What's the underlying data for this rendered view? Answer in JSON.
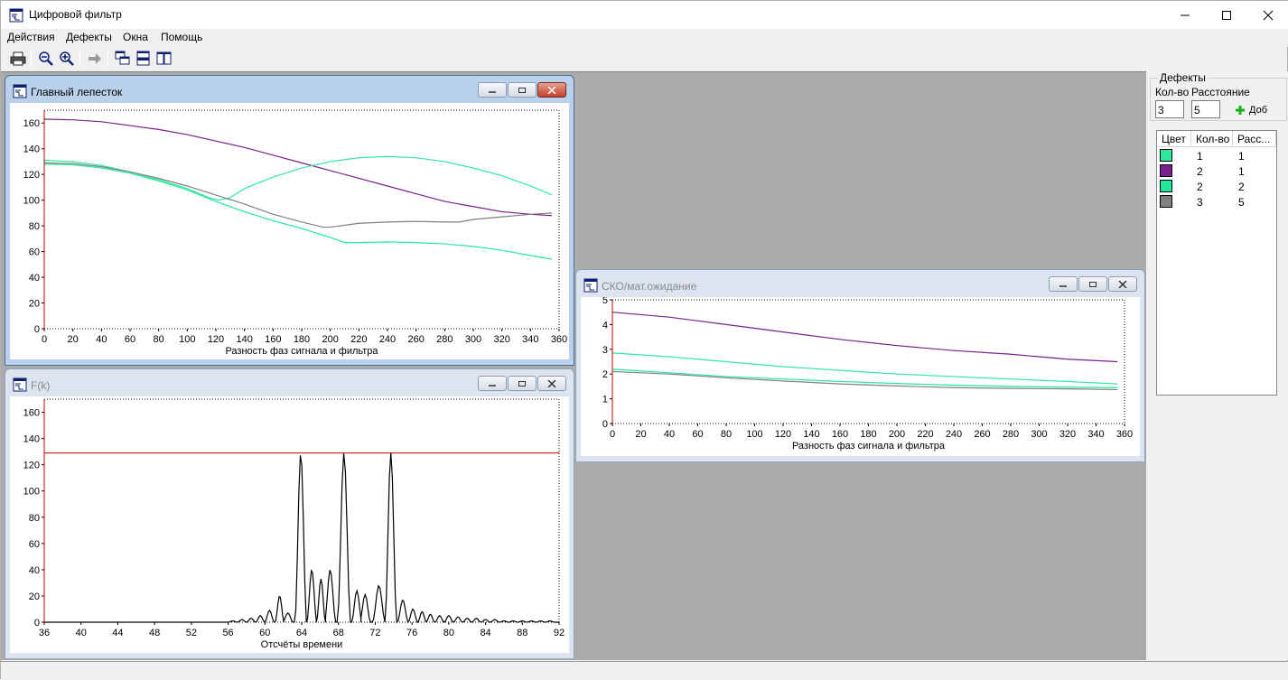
{
  "app": {
    "title": "Цифровой фильтр"
  },
  "menu": {
    "items": [
      "Действия",
      "Дефекты",
      "Окна",
      "Помощь"
    ]
  },
  "windows": {
    "main_lobe": {
      "title": "Главный лепесток"
    },
    "fk": {
      "title": "F(k)"
    },
    "sko": {
      "title": "СКО/мат.ожидание"
    }
  },
  "defects": {
    "group_label": "Дефекты",
    "count_label": "Кол-во",
    "distance_label": "Расстояние",
    "count_value": "3",
    "distance_value": "5",
    "add_label": "Доб",
    "columns": [
      "Цвет",
      "Кол-во",
      "Расс..."
    ],
    "rows": [
      {
        "color": "#2ee8a0",
        "count": "1",
        "distance": "1"
      },
      {
        "color": "#7a1f8e",
        "count": "2",
        "distance": "1"
      },
      {
        "color": "#23e89a",
        "count": "2",
        "distance": "2"
      },
      {
        "color": "#808080",
        "count": "3",
        "distance": "5"
      }
    ]
  },
  "chart_data": [
    {
      "type": "line",
      "xlabel": "Разность фаз сигнала и фильтра",
      "ylabel": "",
      "xlim": [
        0,
        360
      ],
      "ylim": [
        0,
        170
      ],
      "xticks": [
        0,
        20,
        40,
        60,
        80,
        100,
        120,
        140,
        160,
        180,
        200,
        220,
        240,
        260,
        280,
        300,
        320,
        340,
        360
      ],
      "yticks": [
        0,
        20,
        40,
        60,
        80,
        100,
        120,
        140,
        160
      ],
      "series": [
        {
          "color": "#7a1f8e",
          "x": [
            0,
            20,
            40,
            60,
            80,
            100,
            120,
            140,
            160,
            180,
            200,
            220,
            240,
            260,
            280,
            300,
            320,
            340,
            355
          ],
          "y": [
            163,
            162.5,
            161,
            158,
            155,
            151,
            146,
            141,
            135,
            129,
            123,
            117,
            111,
            105,
            99,
            95,
            91,
            89,
            88
          ]
        },
        {
          "color": "#2ee8a0",
          "x": [
            0,
            20,
            40,
            60,
            80,
            100,
            115,
            122,
            130,
            140,
            160,
            180,
            200,
            220,
            240,
            260,
            280,
            300,
            320,
            340,
            355
          ],
          "y": [
            131,
            130,
            127,
            122,
            116,
            109,
            102,
            100,
            102,
            109,
            118,
            125,
            130,
            133,
            134,
            133,
            130,
            125,
            119,
            111,
            104
          ]
        },
        {
          "color": "#23e89a",
          "x": [
            0,
            20,
            40,
            60,
            80,
            100,
            120,
            140,
            160,
            180,
            200,
            210,
            220,
            240,
            260,
            280,
            300,
            320,
            340,
            355
          ],
          "y": [
            128,
            127.5,
            125,
            121,
            115,
            108,
            99,
            91,
            84,
            78,
            71,
            67,
            67,
            67.5,
            67,
            66,
            64,
            61,
            57,
            54
          ]
        },
        {
          "color": "#808080",
          "x": [
            0,
            20,
            40,
            60,
            80,
            100,
            120,
            140,
            160,
            180,
            195,
            200,
            220,
            240,
            260,
            280,
            290,
            300,
            320,
            340,
            355
          ],
          "y": [
            129,
            128.5,
            126,
            122,
            117,
            111,
            104,
            97,
            89,
            83,
            79,
            79,
            82,
            83,
            83.5,
            83,
            83,
            85,
            87,
            89,
            90
          ]
        }
      ]
    },
    {
      "type": "line",
      "xlabel": "Отсчёты времени",
      "ylabel": "",
      "xlim": [
        36,
        92
      ],
      "ylim": [
        0,
        170
      ],
      "xticks": [
        36,
        40,
        44,
        48,
        52,
        56,
        60,
        64,
        68,
        72,
        76,
        80,
        84,
        88,
        92
      ],
      "yticks": [
        0,
        20,
        40,
        60,
        80,
        100,
        120,
        140,
        160
      ],
      "threshold": {
        "value": 129,
        "color": "#c00000"
      },
      "series": [
        {
          "color": "#000000",
          "peaks": [
            {
              "c": 56.5,
              "h": 1
            },
            {
              "c": 57.5,
              "h": 2
            },
            {
              "c": 58.5,
              "h": 3
            },
            {
              "c": 59.5,
              "h": 5
            },
            {
              "c": 60.5,
              "h": 9
            },
            {
              "c": 61.6,
              "h": 20
            },
            {
              "c": 62.5,
              "h": 7
            },
            {
              "c": 63.9,
              "h": 129
            },
            {
              "c": 65.1,
              "h": 40
            },
            {
              "c": 66.1,
              "h": 33
            },
            {
              "c": 67.1,
              "h": 40
            },
            {
              "c": 68.6,
              "h": 129
            },
            {
              "c": 70.0,
              "h": 24
            },
            {
              "c": 70.9,
              "h": 21
            },
            {
              "c": 72.4,
              "h": 28
            },
            {
              "c": 73.7,
              "h": 129
            },
            {
              "c": 75.0,
              "h": 17
            },
            {
              "c": 76.1,
              "h": 10
            },
            {
              "c": 77.1,
              "h": 8
            },
            {
              "c": 78.0,
              "h": 6
            },
            {
              "c": 79.0,
              "h": 5
            },
            {
              "c": 80.0,
              "h": 5
            },
            {
              "c": 81.0,
              "h": 4
            },
            {
              "c": 82.0,
              "h": 3
            },
            {
              "c": 83.0,
              "h": 3
            },
            {
              "c": 84.0,
              "h": 2
            },
            {
              "c": 85.0,
              "h": 2
            },
            {
              "c": 86.0,
              "h": 1
            },
            {
              "c": 87.0,
              "h": 1
            },
            {
              "c": 88.0,
              "h": 1
            },
            {
              "c": 89.0,
              "h": 1
            },
            {
              "c": 90.0,
              "h": 1
            },
            {
              "c": 91.0,
              "h": 1
            }
          ]
        }
      ]
    },
    {
      "type": "line",
      "xlabel": "Разность фаз сигнала и фильтра",
      "ylabel": "",
      "xlim": [
        0,
        360
      ],
      "ylim": [
        0,
        5
      ],
      "xticks": [
        0,
        20,
        40,
        60,
        80,
        100,
        120,
        140,
        160,
        180,
        200,
        220,
        240,
        260,
        280,
        300,
        320,
        340,
        360
      ],
      "yticks": [
        0,
        1,
        2,
        3,
        4,
        5
      ],
      "series": [
        {
          "color": "#7a1f8e",
          "x": [
            0,
            40,
            80,
            120,
            160,
            200,
            240,
            280,
            320,
            355
          ],
          "y": [
            4.5,
            4.3,
            4.0,
            3.7,
            3.4,
            3.15,
            2.95,
            2.8,
            2.6,
            2.5
          ]
        },
        {
          "color": "#2ee8a0",
          "x": [
            0,
            40,
            80,
            120,
            160,
            200,
            240,
            280,
            320,
            355
          ],
          "y": [
            2.85,
            2.7,
            2.5,
            2.3,
            2.15,
            2.0,
            1.9,
            1.8,
            1.7,
            1.6
          ]
        },
        {
          "color": "#23e89a",
          "x": [
            0,
            40,
            80,
            120,
            160,
            200,
            240,
            280,
            320,
            355
          ],
          "y": [
            2.2,
            2.05,
            1.9,
            1.8,
            1.7,
            1.62,
            1.55,
            1.5,
            1.47,
            1.45
          ]
        },
        {
          "color": "#808080",
          "x": [
            0,
            40,
            80,
            120,
            160,
            200,
            240,
            280,
            320,
            355
          ],
          "y": [
            2.1,
            2.0,
            1.85,
            1.72,
            1.6,
            1.52,
            1.45,
            1.42,
            1.4,
            1.37
          ]
        }
      ]
    }
  ]
}
